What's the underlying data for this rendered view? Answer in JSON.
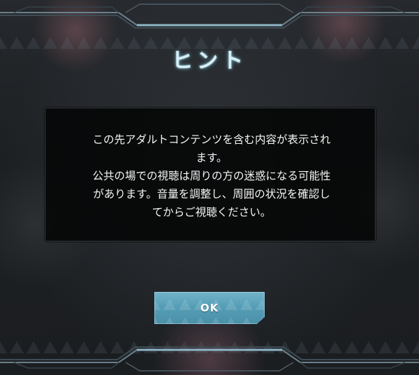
{
  "dialog": {
    "title": "ヒント",
    "message_lines": [
      "この先アダルトコンテンツを含む内容が表示され",
      "ます。",
      "公共の場での視聴は周りの方の迷惑になる可能性",
      "があります。音量を調整し、周囲の状況を確認し",
      "てからご視聴ください。"
    ],
    "ok_label": "OK"
  },
  "colors": {
    "title_glow": "#82c8dc",
    "button": "#5fa9c2",
    "box": "#060708"
  }
}
